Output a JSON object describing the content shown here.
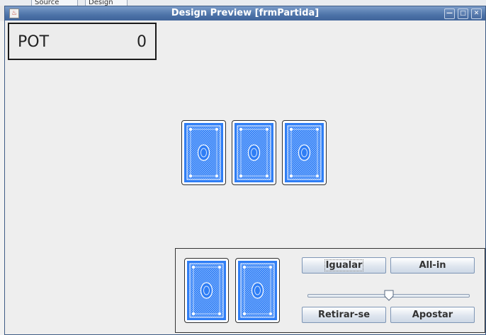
{
  "background": {
    "tabs": [
      "Source",
      "Design"
    ]
  },
  "window": {
    "title": "Design Preview [frmPartida]",
    "controls": [
      "minimize-icon",
      "maximize-icon",
      "close-icon"
    ]
  },
  "pot": {
    "label": "POT",
    "value": "0"
  },
  "community_cards": [
    {
      "face": "back"
    },
    {
      "face": "back"
    },
    {
      "face": "back"
    }
  ],
  "player_cards": [
    {
      "face": "back"
    },
    {
      "face": "back"
    }
  ],
  "actions": {
    "call": "Igualar",
    "all_in": "All-in",
    "fold": "Retirar-se",
    "bet": "Apostar"
  },
  "bet_slider": {
    "value_fraction": 0.5
  },
  "colors": {
    "card_back": "#2f7ef5",
    "title_bar": "#4d73a8"
  }
}
